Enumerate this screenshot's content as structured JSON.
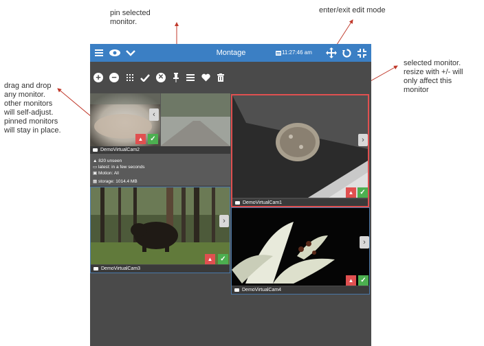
{
  "annotations": {
    "pin": "pin selected\nmonitor.",
    "edit": "enter/exit edit mode",
    "drag": "drag and drop\nany monitor.\nother monitors\nwill self-adjust.\npinned monitors\nwill stay in place.",
    "selected": "selected monitor.\nresize with +/- will\nonly affect this\nmonitor"
  },
  "topbar": {
    "title": "Montage",
    "time": "11:27:46 am",
    "icons": [
      "menu-icon",
      "eye-icon",
      "chevron-down-icon",
      "calendar-icon",
      "move-icon",
      "refresh-icon",
      "collapse-icon"
    ]
  },
  "toolbar": {
    "items": [
      "plus-icon",
      "minus-icon",
      "grid-icon",
      "check-icon",
      "close-icon",
      "pin-icon",
      "list-icon",
      "heart-icon",
      "trash-icon"
    ]
  },
  "monitors": [
    {
      "name": "DemoVirtualCam2"
    },
    {
      "name": "DemoVirtualCam1"
    },
    {
      "name": "DemoVirtualCam3"
    },
    {
      "name": "DemoVirtualCam4"
    }
  ],
  "stats": {
    "unseen": "820 unseen",
    "latest": "latest: in a few seconds",
    "motion": "Motion: All",
    "storage": "storage: 1014.4 MB"
  },
  "colors": {
    "topbar": "#3b7fc4",
    "background": "#4a4a4a",
    "selected_border": "#e05050",
    "alarm": "#e05050",
    "ok": "#4caf50",
    "annotation_arrow": "#c0392b"
  }
}
